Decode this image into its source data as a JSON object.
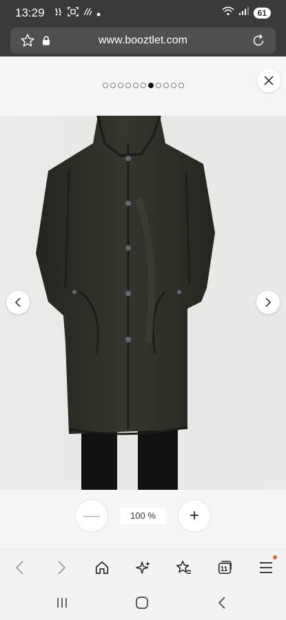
{
  "status_bar": {
    "time": "13:29",
    "battery": "61",
    "left_icons": [
      "voicemail-icon",
      "screenshot-icon",
      "nfc-icon",
      "dot-icon"
    ],
    "right_icons": [
      "wifi-icon",
      "signal-icon",
      "battery-icon"
    ]
  },
  "browser": {
    "url": "www.booztlet.com",
    "icons": [
      "star-icon",
      "lock-icon",
      "reload-icon"
    ]
  },
  "gallery": {
    "total_images": 11,
    "active_index": 6,
    "close_icon": "close-icon"
  },
  "zoom": {
    "value": "100 %",
    "out_symbol": "—",
    "in_symbol": "+"
  },
  "toolbar": {
    "tab_count": "11",
    "items": [
      "back-icon",
      "forward-icon",
      "home-icon",
      "sparkle-icon",
      "bookmarks-icon",
      "tabs-icon",
      "menu-icon"
    ]
  },
  "colors": {
    "status_bg": "#3a3a3a",
    "url_bg": "#505050",
    "coat": "#2f3128",
    "page_bg": "#f6f6f6",
    "accent_dot": "#e8632a"
  }
}
